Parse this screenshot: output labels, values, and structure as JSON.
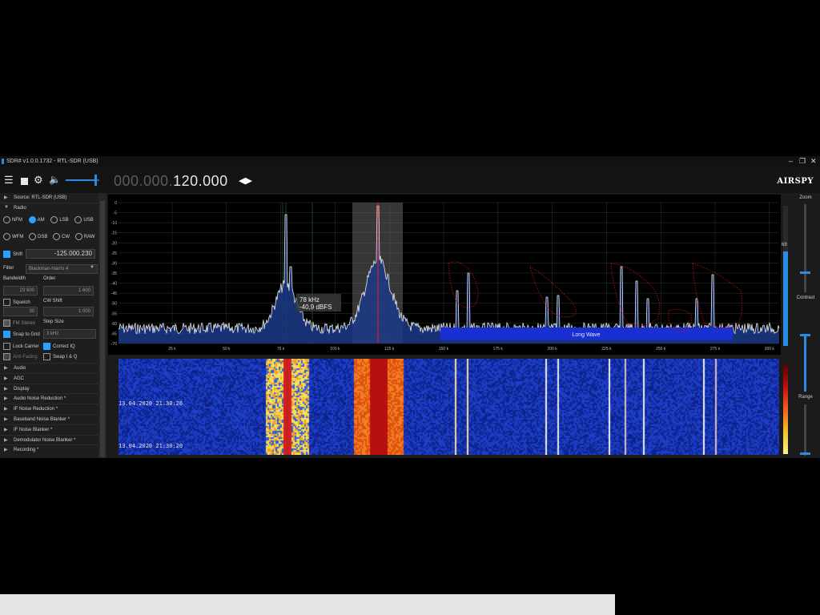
{
  "window": {
    "title": "SDR# v1.0.0.1732 - RTL-SDR (USB)",
    "min_icon": "minimize-icon",
    "max_icon": "maximize-icon",
    "close_icon": "close-icon"
  },
  "toolbar": {
    "freq_dim": "000.000.",
    "freq_lit": "120.000",
    "logo": "AIRSPY"
  },
  "sidebar": {
    "source_label": "Source: RTL-SDR (USB)",
    "radio_label": "Radio",
    "modes_row1": [
      "NFM",
      "AM",
      "LSB",
      "USB"
    ],
    "modes_row2": [
      "WFM",
      "DSB",
      "CW",
      "RAW"
    ],
    "selected_mode": "AM",
    "shift_label": "Shift",
    "shift_value": "-125.000.230",
    "filter_label": "Filter",
    "filter_value": "Blackman-Harris 4",
    "bandwidth_label": "Bandwidth",
    "order_label": "Order",
    "bandwidth_value": "23 600",
    "order_value": "1 600",
    "squelch_label": "Squelch",
    "cw_shift_label": "CW Shift",
    "squelch_value": "30",
    "cw_shift_value": "1 000",
    "fm_stereo_label": "FM Stereo",
    "step_size_label": "Step Size",
    "snap_label": "Snap to Grid",
    "step_value": "3 kHz",
    "lock_carrier_label": "Lock Carrier",
    "correct_iq_label": "Correct IQ",
    "anti_fading_label": "Anti-Fading",
    "swap_iq_label": "Swap I & Q",
    "sections": [
      "Audio",
      "AGC",
      "Display",
      "Audio Noise Reduction *",
      "IF Noise Reduction *",
      "Baseband Noise Blanker *",
      "IF Noise Blanker *",
      "Demodulator Noise Blanker *",
      "Recording *"
    ]
  },
  "spectrum": {
    "y_ticks": [
      "0",
      "-5",
      "-10",
      "-15",
      "-20",
      "-25",
      "-30",
      "-35",
      "-40",
      "-45",
      "-50",
      "-55",
      "-60",
      "-65",
      "-70"
    ],
    "x_ticks": [
      "25 k",
      "50 k",
      "75 k",
      "100 k",
      "125 k",
      "150 k",
      "175 k",
      "200 k",
      "225 k",
      "250 k",
      "275 k",
      "300 k"
    ],
    "cursor_freq": "78 kHz",
    "cursor_level": "-40,9 dBFS",
    "band_label": "Long Wave",
    "level_readout": "69"
  },
  "waterfall": {
    "timestamps": [
      "13.04.2020 21:30:26",
      "13.04.2020 21:30:20"
    ]
  },
  "right_panel": {
    "zoom_label": "Zoom",
    "contrast_label": "Contrast",
    "range_label": "Range"
  }
}
